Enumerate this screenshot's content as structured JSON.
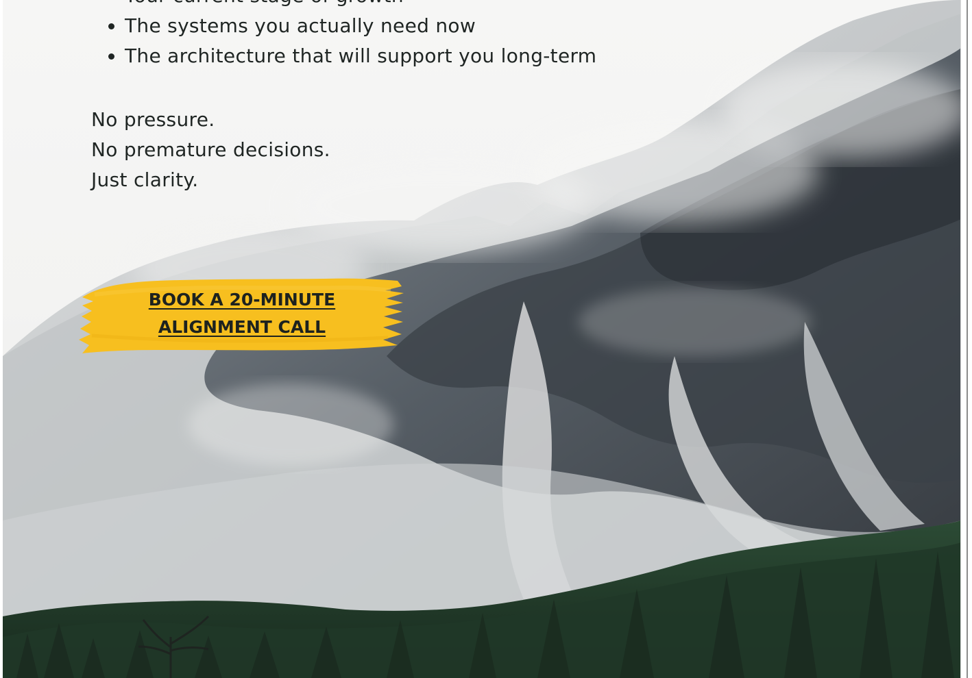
{
  "bullets": [
    "Your current stage of growth",
    "The systems you actually need now",
    "The architecture that will support you long-term"
  ],
  "closing": [
    "No pressure.",
    "No premature decisions.",
    "Just clarity."
  ],
  "cta": {
    "line1": "BOOK A 20-MINUTE",
    "line2": "ALIGNMENT CALL",
    "color": "#f7bf1f"
  },
  "background": {
    "subject": "snowy-mountain-forest-photo"
  }
}
